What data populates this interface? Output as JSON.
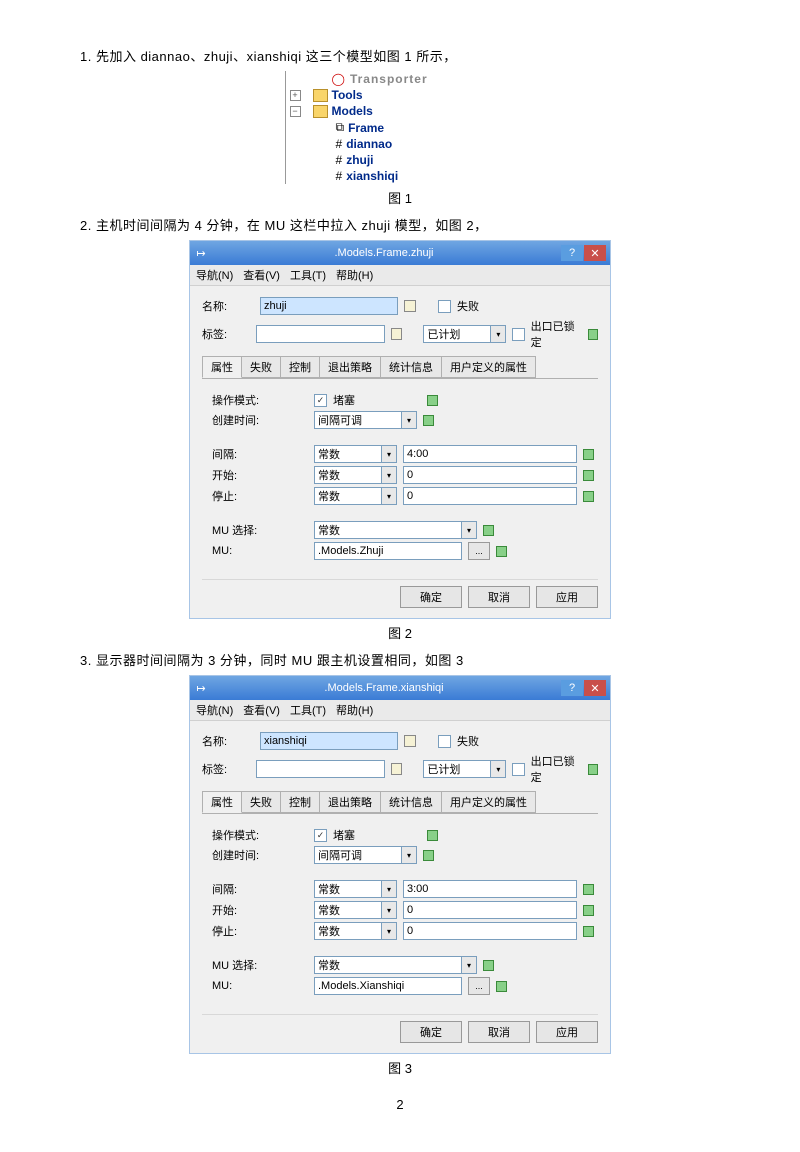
{
  "instr1": "1. 先加入 diannao、zhuji、xianshiqi 这三个模型如图 1 所示，",
  "instr2": "2. 主机时间间隔为 4 分钟，在 MU 这栏中拉入 zhuji 模型，如图 2，",
  "instr3": "3. 显示器时间间隔为 3 分钟，同时 MU 跟主机设置相同，如图 3",
  "captions": {
    "fig1": "图 1",
    "fig2": "图 2",
    "fig3": "图 3"
  },
  "page_number": "2",
  "tree": {
    "items": [
      "Transporter",
      "Tools",
      "Models",
      "Frame",
      "diannao",
      "zhuji",
      "xianshiqi"
    ]
  },
  "menu": {
    "nav": "导航(N)",
    "view": "查看(V)",
    "tools": "工具(T)",
    "help": "帮助(H)"
  },
  "labels": {
    "name": "名称:",
    "tag": "标签:",
    "fail": "失败",
    "plan": "已计划",
    "lock": "出口已锁定",
    "mode": "操作模式:",
    "block": "堵塞",
    "ctime": "创建时间:",
    "adjust": "间隔可调",
    "interval": "间隔:",
    "start": "开始:",
    "stop": "停止:",
    "const": "常数",
    "musel": "MU 选择:",
    "mu": "MU:"
  },
  "tabs": [
    "属性",
    "失败",
    "控制",
    "退出策略",
    "统计信息",
    "用户定义的属性"
  ],
  "buttons": {
    "ok": "确定",
    "cancel": "取消",
    "apply": "应用"
  },
  "dialog2": {
    "title": ".Models.Frame.zhuji",
    "name": "zhuji",
    "interval": "4:00",
    "start": "0",
    "stop": "0",
    "mu": ".Models.Zhuji"
  },
  "dialog3": {
    "title": ".Models.Frame.xianshiqi",
    "name": "xianshiqi",
    "interval": "3:00",
    "start": "0",
    "stop": "0",
    "mu": ".Models.Xianshiqi"
  }
}
